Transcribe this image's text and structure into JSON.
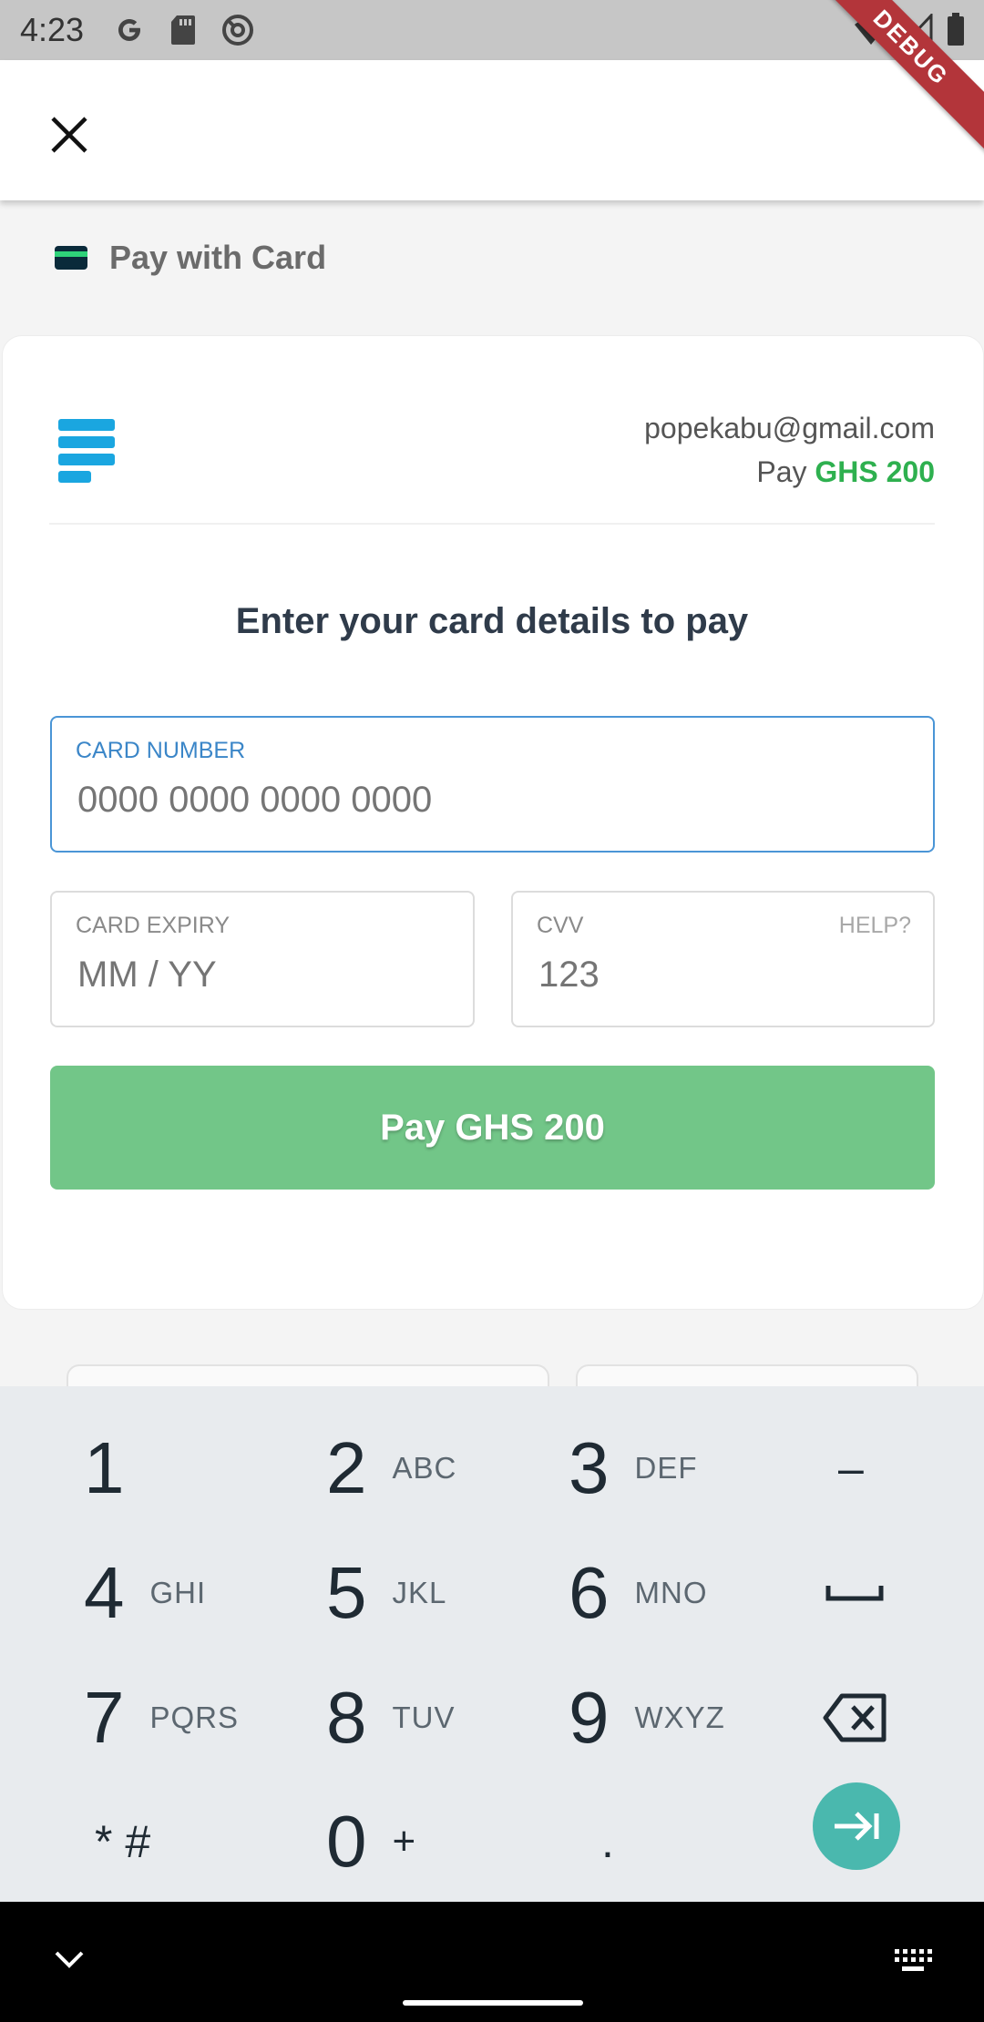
{
  "status_bar": {
    "time": "4:23",
    "debug_label": "DEBUG"
  },
  "header": {
    "close_icon": "close-icon"
  },
  "payment_method": {
    "label": "Pay with Card",
    "icon": "credit-card-icon"
  },
  "merchant": {
    "email": "popekabu@gmail.com",
    "pay_prefix": "Pay",
    "amount": "GHS 200",
    "accent_color": "#2eb04f"
  },
  "form": {
    "heading": "Enter your card details to pay",
    "card_number": {
      "label": "CARD NUMBER",
      "placeholder": "0000 0000 0000 0000",
      "value": ""
    },
    "card_expiry": {
      "label": "CARD EXPIRY",
      "placeholder": "MM / YY",
      "value": ""
    },
    "cvv": {
      "label": "CVV",
      "placeholder": "123",
      "value": "",
      "help": "HELP?"
    },
    "submit_label": "Pay GHS 200",
    "submit_color": "#72c688"
  },
  "keyboard": {
    "rows": [
      [
        {
          "digit": "1",
          "letters": ""
        },
        {
          "digit": "2",
          "letters": "ABC"
        },
        {
          "digit": "3",
          "letters": "DEF"
        },
        {
          "symbol": "–"
        }
      ],
      [
        {
          "digit": "4",
          "letters": "GHI"
        },
        {
          "digit": "5",
          "letters": "JKL"
        },
        {
          "digit": "6",
          "letters": "MNO"
        },
        {
          "symbol": "space"
        }
      ],
      [
        {
          "digit": "7",
          "letters": "PQRS"
        },
        {
          "digit": "8",
          "letters": "TUV"
        },
        {
          "digit": "9",
          "letters": "WXYZ"
        },
        {
          "symbol": "backspace"
        }
      ],
      [
        {
          "digit": "* #",
          "letters": ""
        },
        {
          "digit": "0",
          "letters": "+"
        },
        {
          "digit": ".",
          "letters": ""
        },
        {
          "symbol": "next"
        }
      ]
    ]
  }
}
